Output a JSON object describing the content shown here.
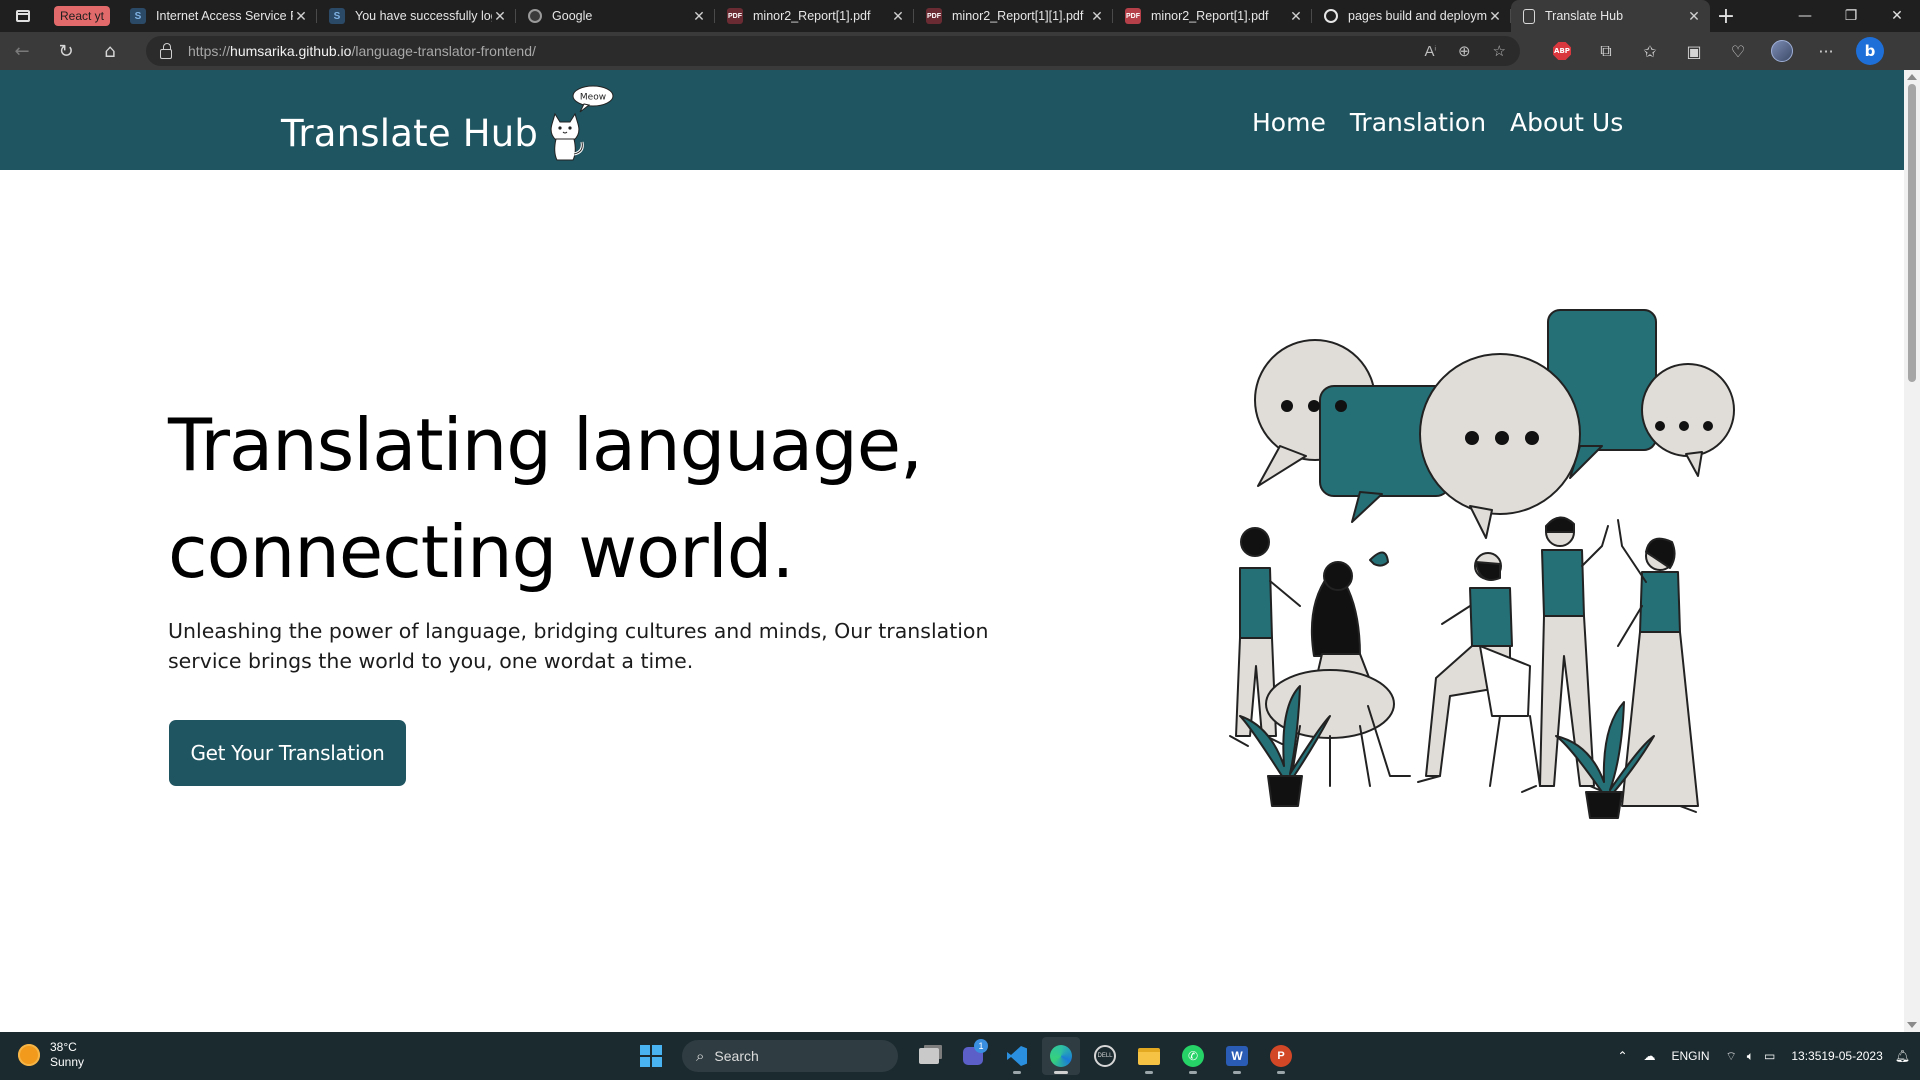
{
  "browser": {
    "tab_group_label": "React yt",
    "tabs": [
      {
        "title": "Internet Access Service Pr",
        "favicon": "s-icon"
      },
      {
        "title": "You have successfully log",
        "favicon": "s-icon"
      },
      {
        "title": "Google",
        "favicon": "google-icon"
      },
      {
        "title": "minor2_Report[1].pdf",
        "favicon": "pdf-icon"
      },
      {
        "title": "minor2_Report[1][1].pdf",
        "favicon": "pdf-icon"
      },
      {
        "title": "minor2_Report[1].pdf",
        "favicon": "pdf-icon"
      },
      {
        "title": "pages build and deploym",
        "favicon": "github-icon"
      },
      {
        "title": "Translate Hub",
        "favicon": "page-icon",
        "active": true
      }
    ],
    "address": {
      "scheme": "https://",
      "host": "humsarika.github.io",
      "path": "/language-translator-frontend/"
    },
    "abp_label": "ABP"
  },
  "site": {
    "brand": "Translate Hub",
    "cat_bubble": "Meow",
    "nav": {
      "home": "Home",
      "translation": "Translation",
      "about": "About Us"
    },
    "hero": {
      "line1": "Translating language,",
      "line2": "connecting world.",
      "description": "Unleashing the power of language, bridging cultures and minds, Our translation service brings the world to you, one wordat a time.",
      "cta": "Get Your Translation"
    },
    "colors": {
      "primary": "#1f5561",
      "accent_teal": "#256f76",
      "bubble_grey": "#e0dcd7"
    }
  },
  "taskbar": {
    "weather": {
      "temp": "38°C",
      "condition": "Sunny"
    },
    "search_label": "Search",
    "chat_badge": "1",
    "lang_top": "ENG",
    "lang_bottom": "IN",
    "time": "13:35",
    "date": "19-05-2023"
  }
}
